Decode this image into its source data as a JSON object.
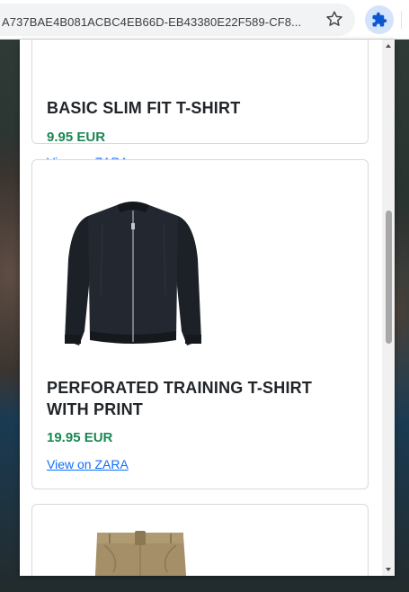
{
  "browser": {
    "url": "A737BAE4B081ACBC4EB66D-EB43380E22F589-CF8...",
    "star_icon": "star-icon",
    "extensions_icon": "puzzle-piece-icon"
  },
  "popup": {
    "products": [
      {
        "title": "BASIC SLIM FIT T-SHIRT",
        "price": "9.95 EUR",
        "link": "View on ZARA",
        "image": "none-visible"
      },
      {
        "title": "PERFORATED TRAINING T-SHIRT WITH PRINT",
        "price": "19.95 EUR",
        "link": "View on ZARA",
        "image": "black-bomber-jacket"
      },
      {
        "image": "khaki-trousers"
      }
    ]
  },
  "colors": {
    "price": "#198754",
    "link": "#0d6efd",
    "title": "#212529",
    "ext_button_bg": "#d3e3fd"
  }
}
